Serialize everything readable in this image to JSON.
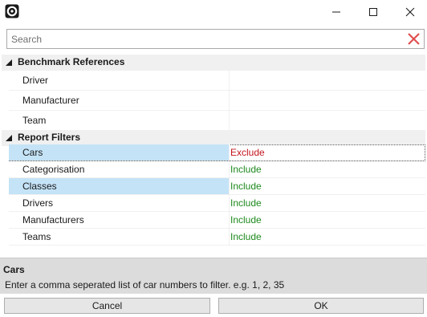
{
  "window": {
    "icons": {
      "app": "app-logo-icon",
      "minimize": "minimize-icon",
      "maximize": "maximize-icon",
      "close": "close-icon"
    }
  },
  "search": {
    "placeholder": "Search",
    "value": "",
    "clear_icon": "clear-x-icon"
  },
  "grid": {
    "categories": [
      {
        "label": "Benchmark References",
        "expanded": true,
        "rows": [
          {
            "name": "Driver",
            "value": ""
          },
          {
            "name": "Manufacturer",
            "value": ""
          },
          {
            "name": "Team",
            "value": ""
          }
        ]
      },
      {
        "label": "Report Filters",
        "expanded": true,
        "rows": [
          {
            "name": "Cars",
            "value": "Exclude",
            "selected": true
          },
          {
            "name": "Categorisation",
            "value": "Include"
          },
          {
            "name": "Classes",
            "value": "Include",
            "selected": true
          },
          {
            "name": "Drivers",
            "value": "Include"
          },
          {
            "name": "Manufacturers",
            "value": "Include"
          },
          {
            "name": "Teams",
            "value": "Include"
          }
        ]
      }
    ]
  },
  "help": {
    "title": "Cars",
    "description": "Enter a comma seperated list of car numbers to filter. e.g. 1, 2, 35"
  },
  "buttons": {
    "cancel": "Cancel",
    "ok": "OK"
  },
  "colors": {
    "selection": "#c4e3f7",
    "exclude": "#c4161c",
    "include": "#1e8a1e",
    "category_bg": "#f0f0f0",
    "help_bg": "#dcdcdc"
  }
}
